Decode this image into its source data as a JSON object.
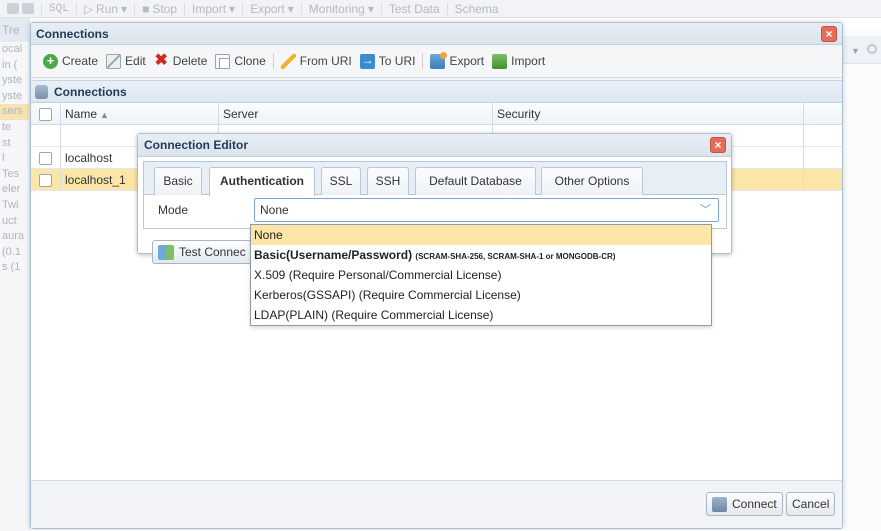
{
  "bg": {
    "toolbar_items": [
      "SQL",
      "Run",
      "Stop",
      "Import",
      "Export",
      "Monitoring",
      "Test Data",
      "Schema"
    ],
    "left_items": [
      "Tre",
      "ocal",
      "in (",
      "yste",
      "yste",
      "sers",
      "te",
      "st",
      "l",
      "Tes",
      "eler",
      "Twi",
      "uct",
      "aura",
      "(0.1",
      "s (1"
    ]
  },
  "window": {
    "title": "Connections",
    "toolbar": {
      "create": "Create",
      "edit": "Edit",
      "delete": "Delete",
      "clone": "Clone",
      "from_uri": "From URI",
      "to_uri": "To URI",
      "export": "Export",
      "import": "Import"
    },
    "grid": {
      "title": "Connections",
      "columns": [
        "Name",
        "Server",
        "Security"
      ],
      "rows": [
        {
          "name": "localhost",
          "server": "",
          "security": "",
          "selected": false
        },
        {
          "name": "localhost_1",
          "server": "",
          "security": "",
          "selected": true
        }
      ]
    },
    "footer": {
      "connect": "Connect",
      "cancel": "Cancel"
    }
  },
  "editor": {
    "title": "Connection Editor",
    "tabs": [
      "Basic",
      "Authentication",
      "SSL",
      "SSH",
      "Default Database",
      "Other Options"
    ],
    "active_tab": "Authentication",
    "mode_label": "Mode",
    "mode_value": "None",
    "test_button": "Test Connec",
    "options": [
      {
        "main": "None",
        "small": "",
        "highlight": true
      },
      {
        "main": "Basic(Username/Password)",
        "small": "(SCRAM-SHA-256, SCRAM-SHA-1 or MONGODB-CR)",
        "highlight": false
      },
      {
        "main": "X.509 (Require Personal/Commercial License)",
        "small": "",
        "highlight": false
      },
      {
        "main": "Kerberos(GSSAPI) (Require Commercial License)",
        "small": "",
        "highlight": false
      },
      {
        "main": "LDAP(PLAIN) (Require Commercial License)",
        "small": "",
        "highlight": false
      }
    ]
  },
  "colors": {
    "selection": "#fbe6a7",
    "title_text": "#1f3b57",
    "close_button": "#e46d5c"
  }
}
